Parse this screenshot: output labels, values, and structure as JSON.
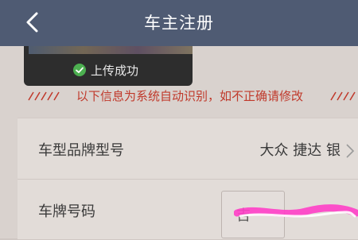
{
  "header": {
    "title": "车主注册",
    "back_icon": "chevron-left-icon"
  },
  "upload": {
    "status_text": "上传成功",
    "status_icon": "check-circle-icon"
  },
  "notice": {
    "text": "以下信息为系统自动识别，如不正确请修改",
    "color": "#c0392b"
  },
  "form": {
    "rows": [
      {
        "label": "车型品牌型号",
        "value": "大众 捷达 银"
      },
      {
        "label": "车牌号码",
        "plate_prefix": "吉"
      }
    ]
  },
  "colors": {
    "header": "#4f5b73",
    "accent_red": "#c0392b",
    "success_green": "#4caf50"
  }
}
